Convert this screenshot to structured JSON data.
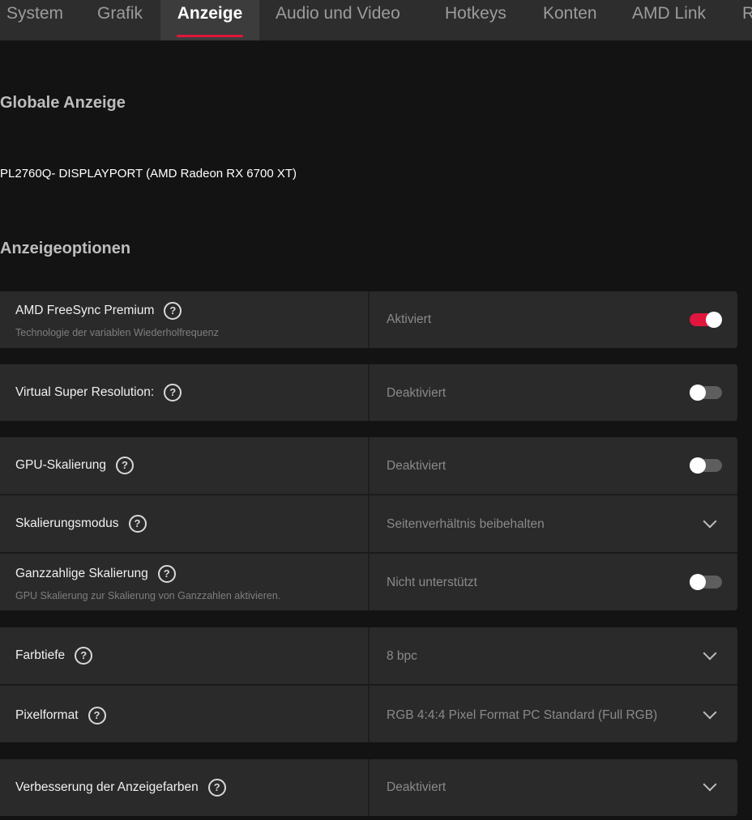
{
  "tabs": [
    {
      "label": "System"
    },
    {
      "label": "Grafik"
    },
    {
      "label": "Anzeige"
    },
    {
      "label": "Audio und Video"
    },
    {
      "label": "Hotkeys"
    },
    {
      "label": "Konten"
    },
    {
      "label": "AMD Link"
    },
    {
      "label": "R"
    }
  ],
  "global": {
    "title": "Globale Anzeige",
    "display_name": "PL2760Q- DISPLAYPORT (AMD Radeon RX 6700 XT)"
  },
  "options": {
    "title": "Anzeigeoptionen",
    "freesync": {
      "label": "AMD FreeSync Premium",
      "sub": "Technologie der variablen Wiederholfrequenz",
      "value": "Aktiviert",
      "enabled": true
    },
    "vsr": {
      "label": "Virtual Super Resolution:",
      "value": "Deaktiviert",
      "enabled": false
    },
    "gpu_scaling": {
      "label": "GPU-Skalierung",
      "value": "Deaktiviert",
      "enabled": false
    },
    "scaling_mode": {
      "label": "Skalierungsmodus",
      "value": "Seitenverhältnis beibehalten"
    },
    "integer_scaling": {
      "label": "Ganzzahlige Skalierung",
      "sub": "GPU Skalierung zur Skalierung von Ganzzahlen aktivieren.",
      "value": "Nicht unterstützt",
      "enabled": false
    },
    "color_depth": {
      "label": "Farbtiefe",
      "value": "8 bpc"
    },
    "pixel_format": {
      "label": "Pixelformat",
      "value": "RGB 4:4:4 Pixel Format PC Standard (Full RGB)"
    },
    "color_enhance": {
      "label": "Verbesserung der Anzeigefarben",
      "value": "Deaktiviert"
    }
  },
  "icons": {
    "help": "?"
  },
  "colors": {
    "accent": "#e1163c",
    "panel": "#2a2a2a",
    "background": "#131313",
    "nav": "#2d2d2d"
  }
}
